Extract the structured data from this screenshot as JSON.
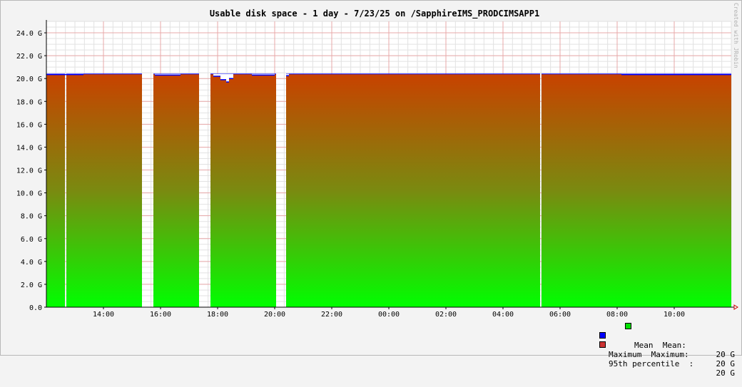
{
  "chart_data": {
    "type": "area",
    "title": "Usable disk space - 1 day - 7/23/25 on /SapphireIMS_PRODCIMSAPP1",
    "watermark": "Created with JRobin",
    "y_unit": "G",
    "ylim": [
      0,
      25
    ],
    "yticks": [
      "0.0",
      "2.0 G",
      "4.0 G",
      "6.0 G",
      "8.0 G",
      "10.0 G",
      "12.0 G",
      "14.0 G",
      "16.0 G",
      "18.0 G",
      "20.0 G",
      "22.0 G",
      "24.0 G"
    ],
    "ytick_values": [
      0,
      2,
      4,
      6,
      8,
      10,
      12,
      14,
      16,
      18,
      20,
      22,
      24
    ],
    "x_range_hours": [
      12.0,
      36.0
    ],
    "xticks": [
      "14:00",
      "16:00",
      "18:00",
      "20:00",
      "22:00",
      "00:00",
      "02:00",
      "04:00",
      "06:00",
      "08:00",
      "10:00"
    ],
    "xtick_hours": [
      14,
      16,
      18,
      20,
      22,
      24,
      26,
      28,
      30,
      32,
      34
    ],
    "grid": true,
    "series": [
      {
        "name": "Mean",
        "color": "#00e000"
      },
      {
        "name": "Maximum",
        "color": "#0000ff"
      },
      {
        "name": "95th percentile",
        "color": "#cc3333"
      }
    ],
    "mean_segments": [
      {
        "start": 12.0,
        "end": 12.65,
        "value": 20.4
      },
      {
        "start": 12.7,
        "end": 15.35,
        "value": 20.4
      },
      {
        "start": 15.75,
        "end": 17.35,
        "value": 20.4
      },
      {
        "start": 17.75,
        "end": 20.05,
        "value": 20.4
      },
      {
        "start": 20.4,
        "end": 29.3,
        "value": 20.4
      },
      {
        "start": 29.35,
        "end": 36.0,
        "value": 20.4
      }
    ],
    "maximum_dips": [
      {
        "start": 12.0,
        "end": 13.3,
        "value": 20.35
      },
      {
        "start": 15.8,
        "end": 16.7,
        "value": 20.3
      },
      {
        "start": 17.85,
        "end": 18.1,
        "value": 20.2
      },
      {
        "start": 18.1,
        "end": 18.3,
        "value": 19.9
      },
      {
        "start": 18.3,
        "end": 18.4,
        "value": 19.7
      },
      {
        "start": 18.4,
        "end": 18.55,
        "value": 20.0
      },
      {
        "start": 19.2,
        "end": 20.0,
        "value": 20.3
      },
      {
        "start": 20.4,
        "end": 20.5,
        "value": 20.25
      },
      {
        "start": 32.15,
        "end": 36.0,
        "value": 20.35
      }
    ],
    "legend": [
      {
        "name": "Mean",
        "label": "Mean  Mean:",
        "value": "20 G",
        "color": "#00e000"
      },
      {
        "name": "Maximum",
        "label": "Maximum  Maximum:",
        "value": "20 G",
        "color": "#0000ff"
      },
      {
        "name": "95th percentile",
        "label": "95th percentile  :",
        "value": "20 G",
        "color": "#cc3333"
      }
    ]
  }
}
